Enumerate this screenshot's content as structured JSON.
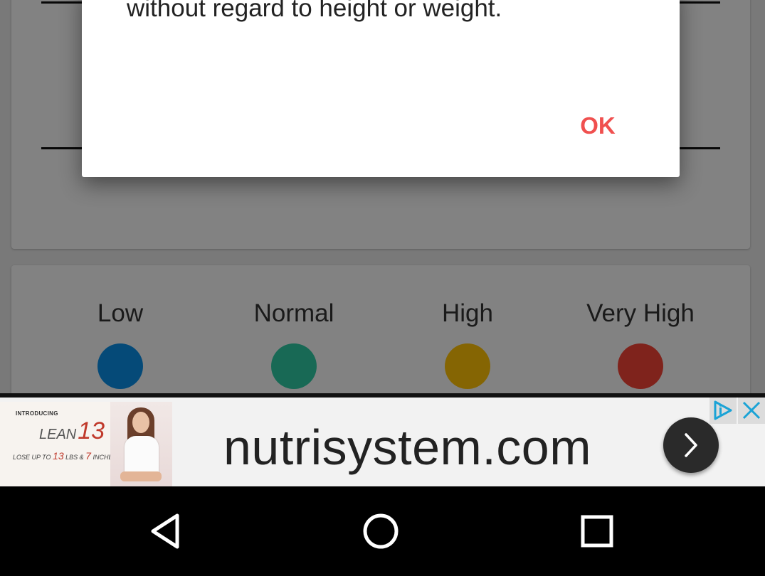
{
  "dialog": {
    "message": "without regard to height or weight.",
    "ok_label": "OK"
  },
  "legend": {
    "items": [
      {
        "label": "Low",
        "color": "#0b8fe6"
      },
      {
        "label": "Normal",
        "color": "#2fc9a3"
      },
      {
        "label": "High",
        "color": "#ffc107"
      },
      {
        "label": "Very High",
        "color": "#f44336"
      }
    ]
  },
  "ad": {
    "intro": "INTRODUCING",
    "product": "LEAN",
    "product_number": "13",
    "tagline_prefix": "LOSE UP TO",
    "tagline_lbs": "13",
    "tagline_mid": "LBS &",
    "tagline_inches": "7",
    "tagline_suffix": "INCHES",
    "domain": "nutrisystem.com",
    "colors": {
      "accent": "#1aa3d6",
      "button": "#2a2a2a"
    }
  },
  "navbar": {
    "icons": [
      "back-icon",
      "home-icon",
      "recents-icon"
    ]
  }
}
